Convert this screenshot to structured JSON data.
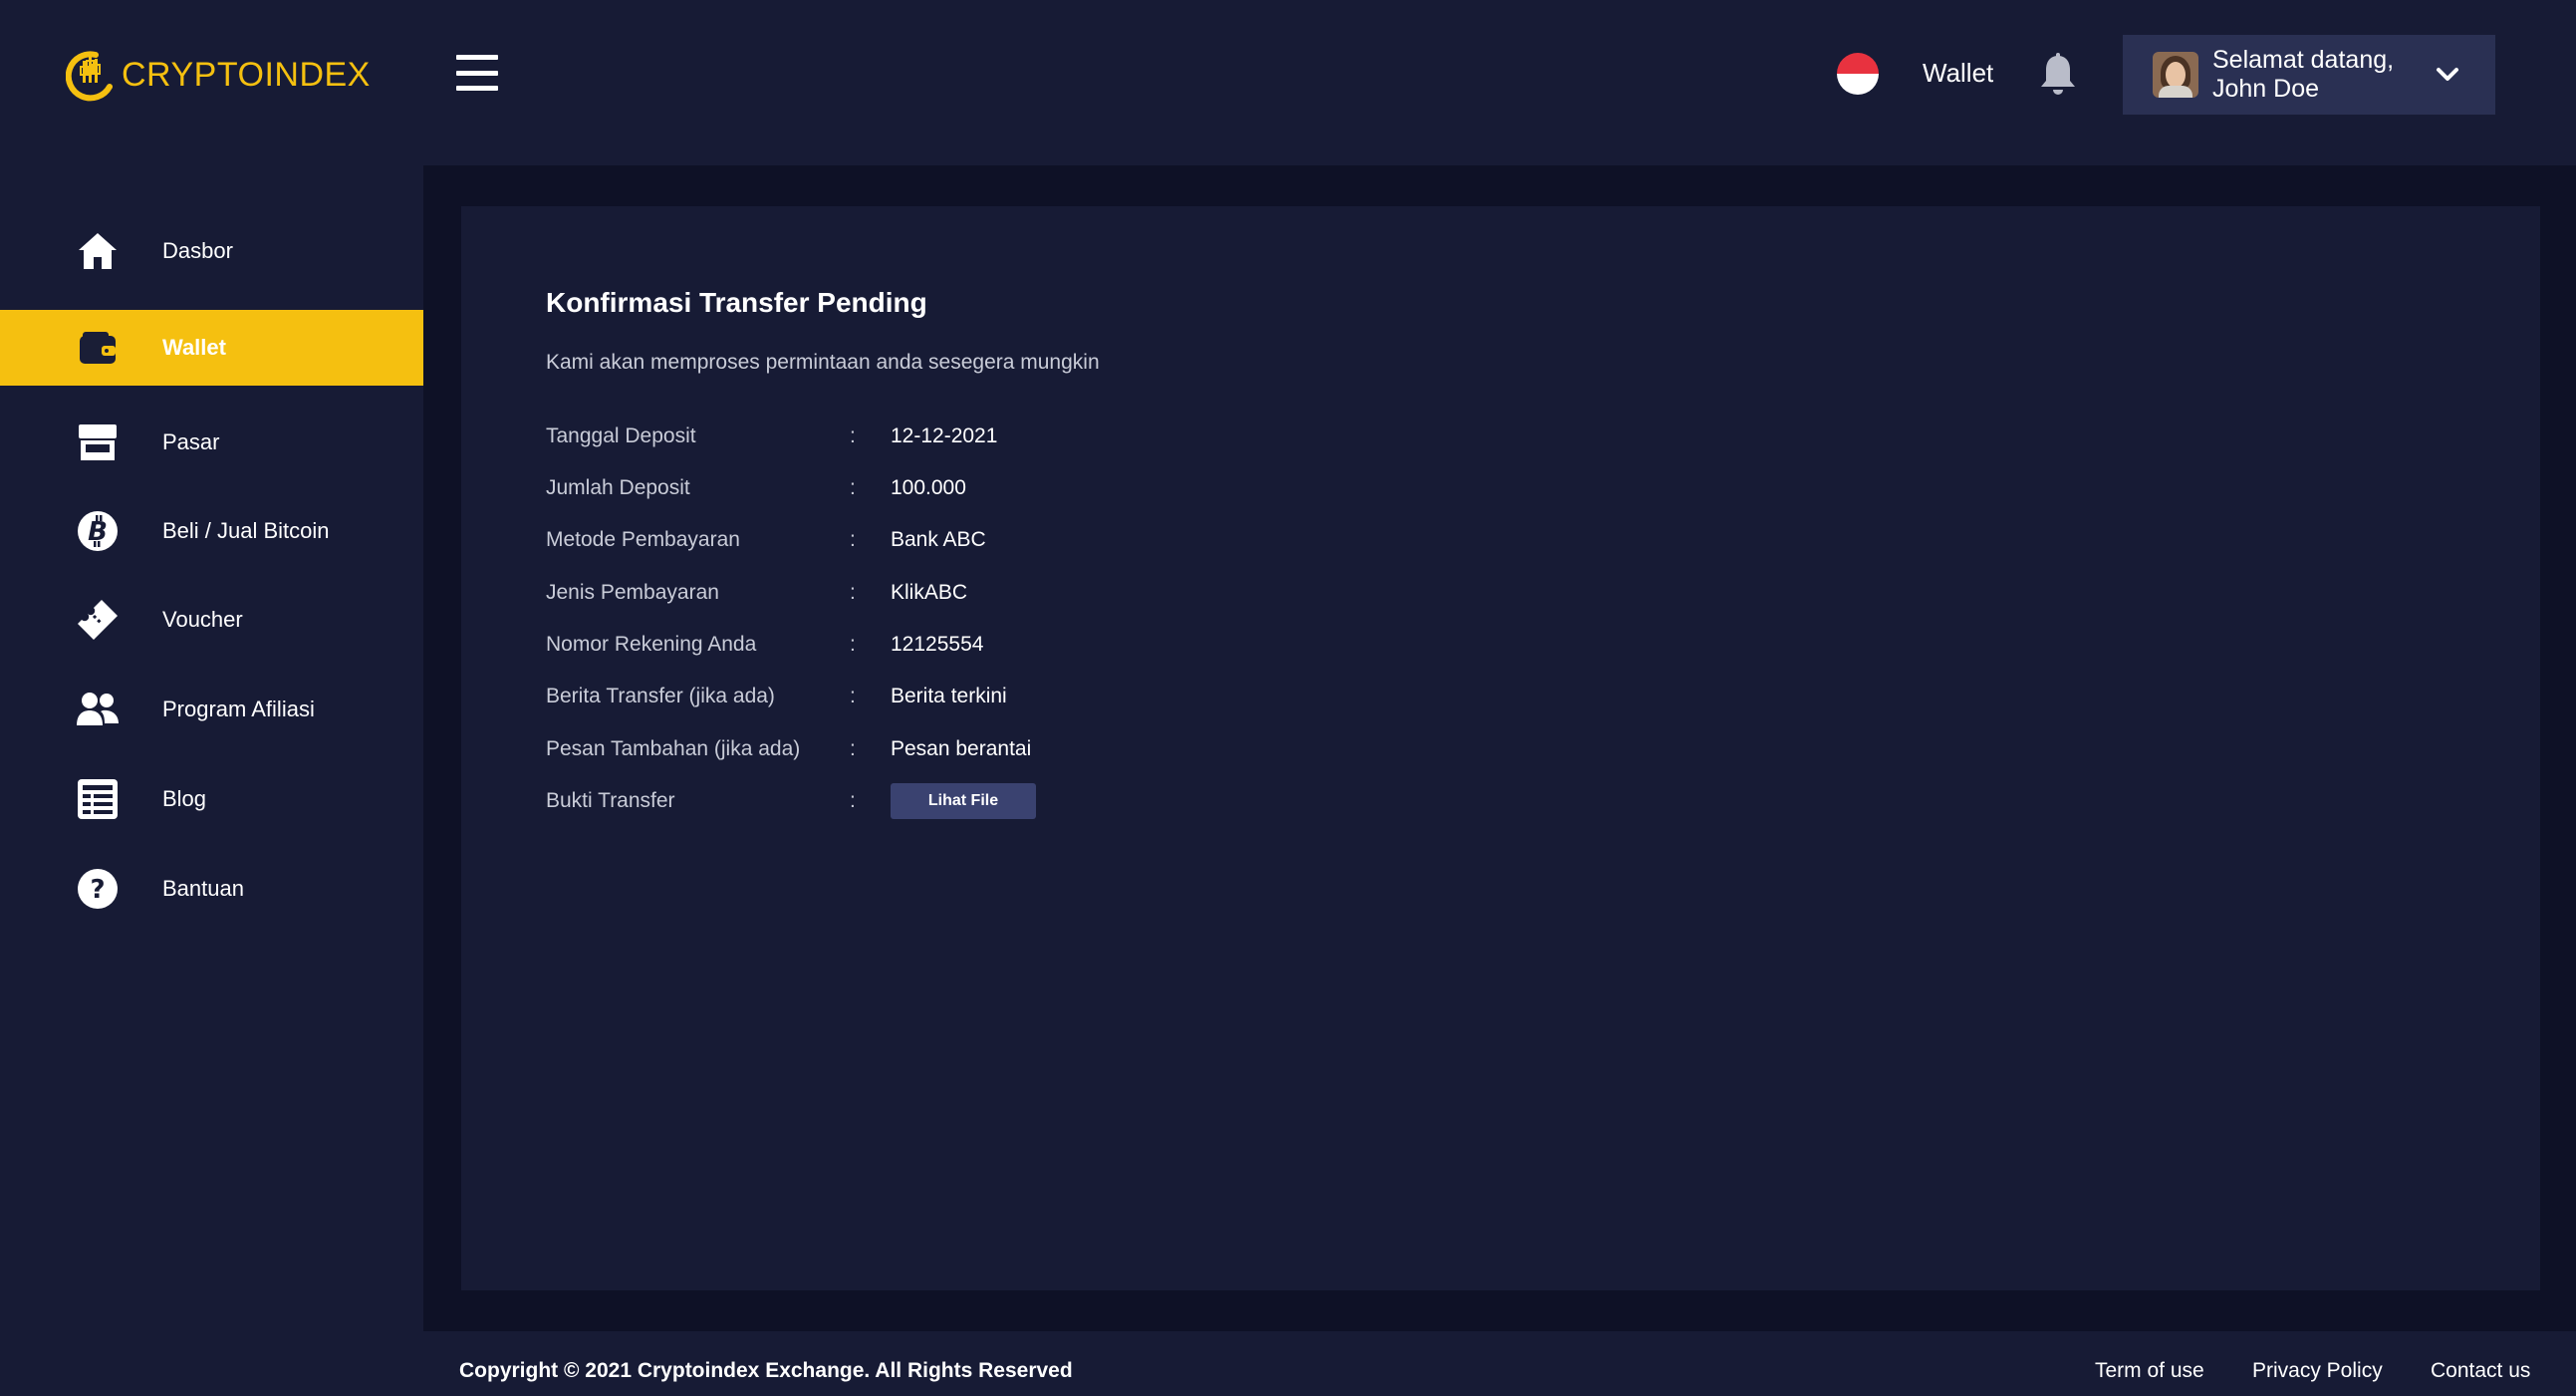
{
  "brand": {
    "name": "CRYPTOINDEX",
    "color": "#f5c010"
  },
  "header": {
    "wallet_label": "Wallet",
    "greeting_line1": "Selamat datang,",
    "greeting_line2": "John Doe",
    "language_flag": "indonesia-flag-icon"
  },
  "sidebar": {
    "items": [
      {
        "label": "Dasbor",
        "icon": "home-icon",
        "active": false
      },
      {
        "label": "Wallet",
        "icon": "wallet-icon",
        "active": true
      },
      {
        "label": "Pasar",
        "icon": "store-icon",
        "active": false
      },
      {
        "label": "Beli / Jual Bitcoin",
        "icon": "bitcoin-icon",
        "active": false
      },
      {
        "label": "Voucher",
        "icon": "ticket-icon",
        "active": false
      },
      {
        "label": "Program Afiliasi",
        "icon": "users-icon",
        "active": false
      },
      {
        "label": "Blog",
        "icon": "newspaper-icon",
        "active": false
      },
      {
        "label": "Bantuan",
        "icon": "help-icon",
        "active": false
      }
    ],
    "active_color": "#f5c010"
  },
  "main": {
    "title": "Konfirmasi Transfer Pending",
    "subtitle": "Kami akan memproses permintaan anda sesegera mungkin",
    "details": [
      {
        "label": "Tanggal Deposit",
        "value": "12-12-2021"
      },
      {
        "label": "Jumlah Deposit",
        "value": "100.000"
      },
      {
        "label": "Metode Pembayaran",
        "value": "Bank ABC"
      },
      {
        "label": "Jenis Pembayaran",
        "value": "KlikABC"
      },
      {
        "label": "Nomor Rekening Anda",
        "value": "12125554"
      },
      {
        "label": "Berita Transfer (jika ada)",
        "value": "Berita terkini"
      },
      {
        "label": "Pesan Tambahan (jika ada)",
        "value": "Pesan berantai"
      },
      {
        "label": "Bukti Transfer",
        "button": "Lihat File"
      }
    ],
    "separator": ":"
  },
  "footer": {
    "copyright": "Copyright © 2021 Cryptoindex Exchange. All Rights Reserved",
    "links": [
      "Term of use",
      "Privacy Policy",
      "Contact us"
    ]
  }
}
